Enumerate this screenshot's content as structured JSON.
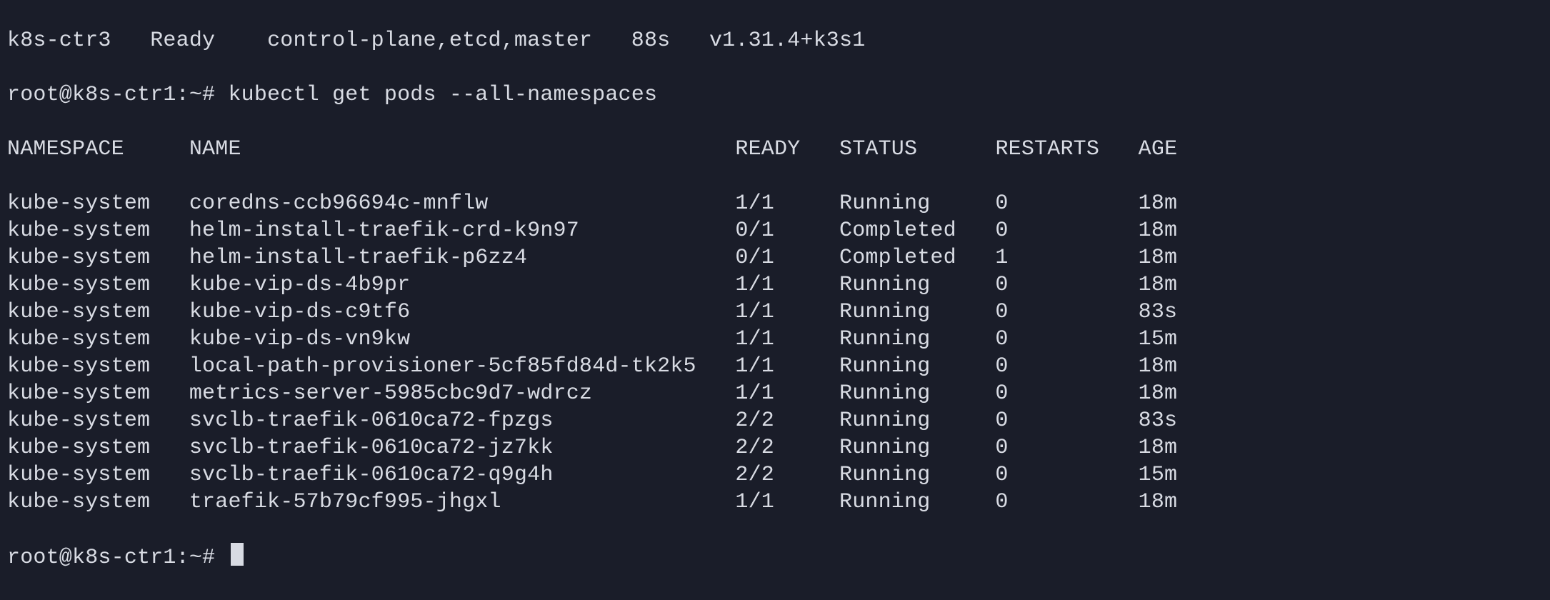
{
  "colors": {
    "bg": "#1a1d29",
    "fg": "#d8dbe3"
  },
  "prev_node_row": {
    "node": "k8s-ctr3",
    "status": "Ready",
    "roles": "control-plane,etcd,master",
    "age": "88s",
    "version": "v1.31.4+k3s1"
  },
  "prompts": [
    {
      "prompt": "root@k8s-ctr1:~#",
      "command": "kubectl get pods --all-namespaces"
    },
    {
      "prompt": "root@k8s-ctr1:~#",
      "command": ""
    }
  ],
  "table": {
    "headers": {
      "namespace": "NAMESPACE",
      "name": "NAME",
      "ready": "READY",
      "status": "STATUS",
      "restarts": "RESTARTS",
      "age": "AGE"
    },
    "rows": [
      {
        "namespace": "kube-system",
        "name": "coredns-ccb96694c-mnflw",
        "ready": "1/1",
        "status": "Running",
        "restarts": "0",
        "age": "18m"
      },
      {
        "namespace": "kube-system",
        "name": "helm-install-traefik-crd-k9n97",
        "ready": "0/1",
        "status": "Completed",
        "restarts": "0",
        "age": "18m"
      },
      {
        "namespace": "kube-system",
        "name": "helm-install-traefik-p6zz4",
        "ready": "0/1",
        "status": "Completed",
        "restarts": "1",
        "age": "18m"
      },
      {
        "namespace": "kube-system",
        "name": "kube-vip-ds-4b9pr",
        "ready": "1/1",
        "status": "Running",
        "restarts": "0",
        "age": "18m"
      },
      {
        "namespace": "kube-system",
        "name": "kube-vip-ds-c9tf6",
        "ready": "1/1",
        "status": "Running",
        "restarts": "0",
        "age": "83s"
      },
      {
        "namespace": "kube-system",
        "name": "kube-vip-ds-vn9kw",
        "ready": "1/1",
        "status": "Running",
        "restarts": "0",
        "age": "15m"
      },
      {
        "namespace": "kube-system",
        "name": "local-path-provisioner-5cf85fd84d-tk2k5",
        "ready": "1/1",
        "status": "Running",
        "restarts": "0",
        "age": "18m"
      },
      {
        "namespace": "kube-system",
        "name": "metrics-server-5985cbc9d7-wdrcz",
        "ready": "1/1",
        "status": "Running",
        "restarts": "0",
        "age": "18m"
      },
      {
        "namespace": "kube-system",
        "name": "svclb-traefik-0610ca72-fpzgs",
        "ready": "2/2",
        "status": "Running",
        "restarts": "0",
        "age": "83s"
      },
      {
        "namespace": "kube-system",
        "name": "svclb-traefik-0610ca72-jz7kk",
        "ready": "2/2",
        "status": "Running",
        "restarts": "0",
        "age": "18m"
      },
      {
        "namespace": "kube-system",
        "name": "svclb-traefik-0610ca72-q9g4h",
        "ready": "2/2",
        "status": "Running",
        "restarts": "0",
        "age": "15m"
      },
      {
        "namespace": "kube-system",
        "name": "traefik-57b79cf995-jhgxl",
        "ready": "1/1",
        "status": "Running",
        "restarts": "0",
        "age": "18m"
      }
    ]
  },
  "col_widths": {
    "namespace": 14,
    "name": 42,
    "ready": 8,
    "status": 12,
    "restarts": 11
  },
  "node_col_widths": {
    "node": 11,
    "status": 9,
    "roles": 28,
    "age": 6
  }
}
